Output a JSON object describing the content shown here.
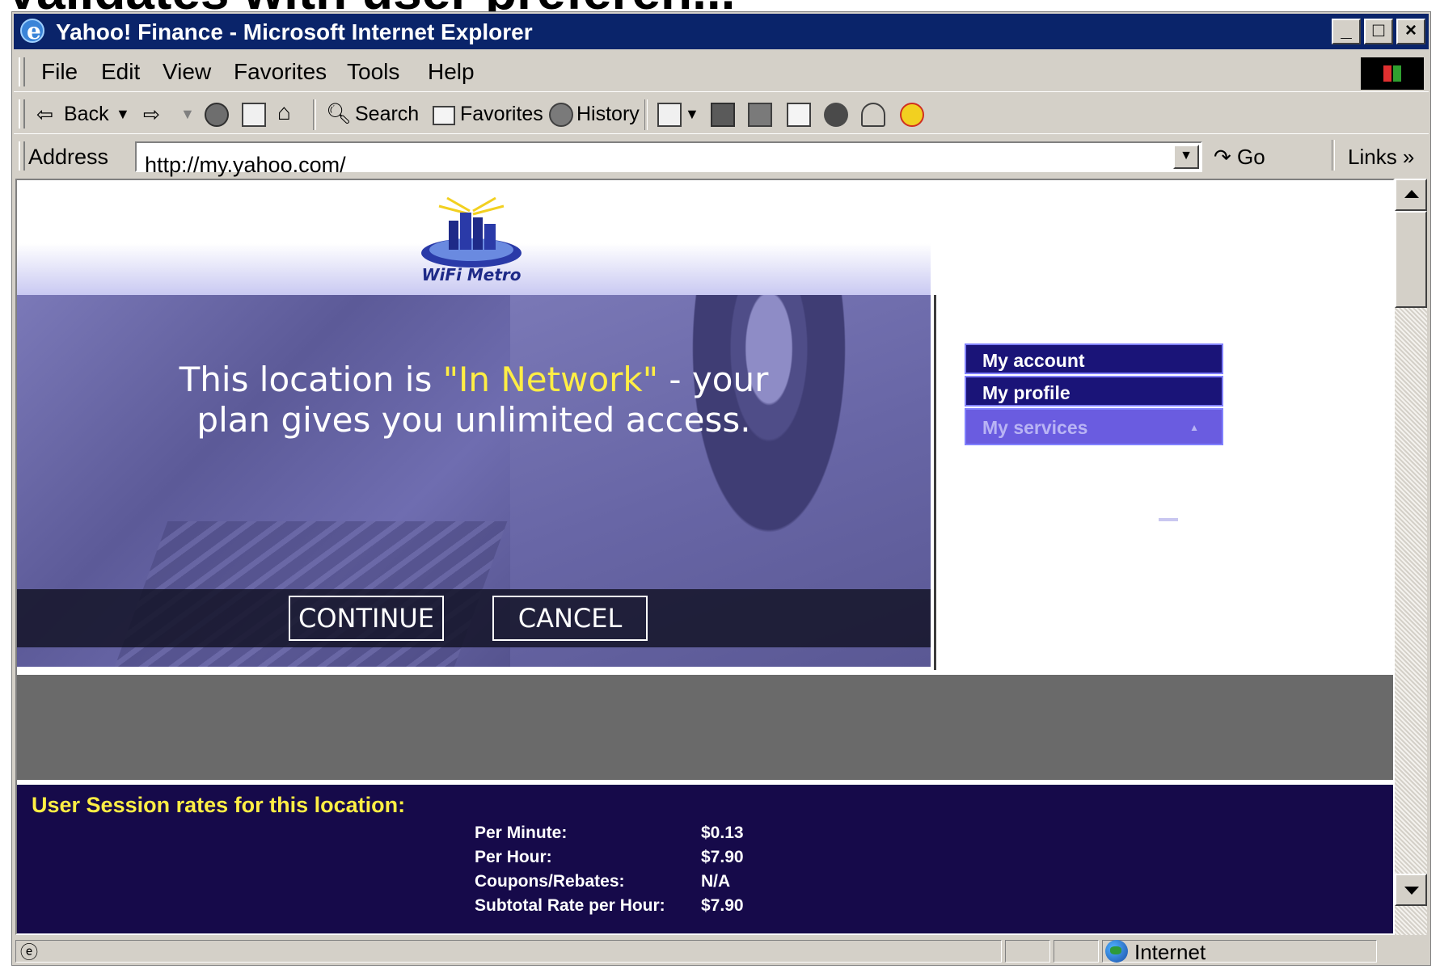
{
  "slide": {
    "title": "Validates with user preferen..."
  },
  "window": {
    "title": "Yahoo! Finance - Microsoft Internet Explorer",
    "minimize": "_",
    "maximize": "□",
    "close": "×"
  },
  "menu": [
    "File",
    "Edit",
    "View",
    "Favorites",
    "Tools",
    "Help"
  ],
  "toolbar": {
    "back": "Back",
    "search": "Search",
    "favorites": "Favorites",
    "history": "History"
  },
  "address": {
    "label": "Address",
    "url": "http://my.yahoo.com/",
    "go": "Go",
    "links": "Links »"
  },
  "page": {
    "hero_text_1": "This location is ",
    "hero_highlight": "\"In Network\"",
    "hero_text_2": " - your",
    "hero_text_3": "plan gives you unlimited access.",
    "continue_label": "CONTINUE",
    "cancel_label": "CANCEL",
    "side_menu": [
      "My account",
      "My profile",
      "My services"
    ],
    "rates_title": "User Session rates for this location:",
    "rates": [
      {
        "label": "Per Minute:",
        "value": "$0.13"
      },
      {
        "label": "Per Hour:",
        "value": "$7.90"
      },
      {
        "label": "Coupons/Rebates:",
        "value": "N/A"
      },
      {
        "label": "Subtotal Rate per Hour:",
        "value": "$7.90"
      }
    ]
  },
  "status": {
    "zone": "Internet"
  },
  "colors": {
    "highlight": "#ffee44",
    "title_bar": "#0a246a",
    "rates_bg": "#160a4a",
    "menu_bg": "#1a1478"
  }
}
